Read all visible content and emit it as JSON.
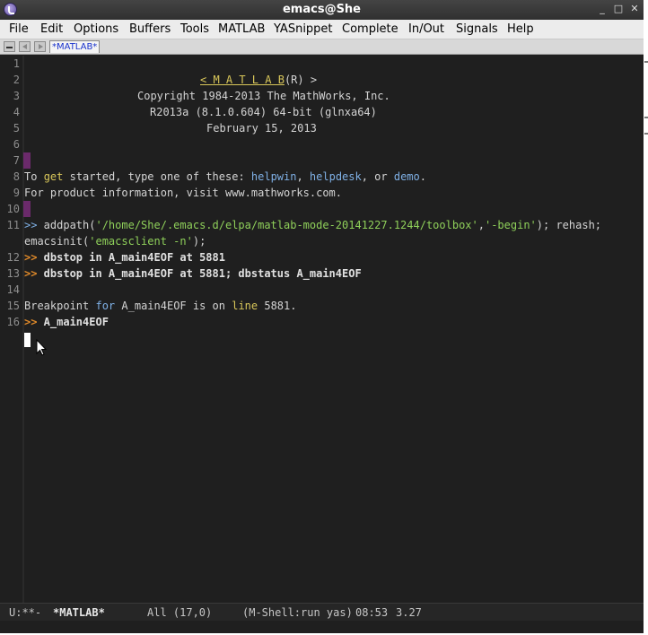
{
  "window": {
    "title": "emacs@She",
    "controls": {
      "minimize": "_",
      "maximize": "□",
      "close": "✕"
    }
  },
  "menu": [
    "File",
    "Edit",
    "Options",
    "Buffers",
    "Tools",
    "MATLAB",
    "YASnippet",
    "Complete",
    "In/Out",
    "Signals",
    "Help"
  ],
  "tab": {
    "label": "*MATLAB*"
  },
  "editor": {
    "line_numbers": [
      "1",
      "2",
      "3",
      "4",
      "5",
      "6",
      "7",
      "8",
      "9",
      "10",
      "11",
      "",
      "12",
      "13",
      "14",
      "15",
      "16"
    ],
    "banner": {
      "lt": "< ",
      "matlab": "M A T L A B",
      "suffix": "(R) >",
      "copyright": "Copyright 1984-2013 The MathWorks, Inc.",
      "version": "R2013a (8.1.0.604) 64-bit (glnxa64)",
      "date": "February 15, 2013"
    },
    "intro": {
      "to": "To ",
      "get": "get",
      "started": " started, type one of these: ",
      "helpwin": "helpwin",
      "c1": ", ",
      "helpdesk": "helpdesk",
      "c2": ", or ",
      "demo": "demo",
      "dot": ".",
      "info": "For product information, visit www.mathworks.com."
    },
    "cmd11": {
      "prompt": ">>",
      "pre": " addpath(",
      "path": "'/home/She/.emacs.d/elpa/matlab-mode-20141227.1244/toolbox'",
      "comma": ",",
      "flag": "'-begin'",
      "post": "); rehash;",
      "cont_pre": "emacsinit(",
      "cont_str": "'emacsclient -n'",
      "cont_post": ");"
    },
    "cmd12": {
      "prompt": ">>",
      "text": " dbstop in A_main4EOF at 5881"
    },
    "cmd13": {
      "prompt": ">>",
      "text": " dbstop in A_main4EOF at 5881; dbstatus A_main4EOF"
    },
    "bp": {
      "pre": "Breakpoint ",
      "for": "for",
      "mid": " A_main4EOF is on ",
      "line": "line",
      "post": " 5881."
    },
    "cmd16": {
      "prompt": ">>",
      "text": " A_main4EOF"
    }
  },
  "modeline": {
    "status": "U:**-",
    "buffer": "*MATLAB*",
    "position": "All (17,0)",
    "mode": "(M-Shell:run yas)",
    "time": "08:53",
    "load": "3.27"
  }
}
